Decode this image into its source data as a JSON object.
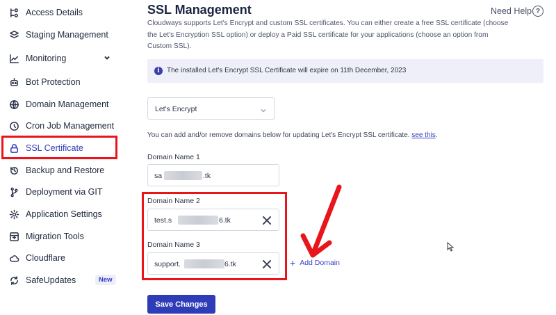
{
  "sidebar": {
    "items": [
      {
        "label": "Access Details"
      },
      {
        "label": "Staging Management"
      },
      {
        "label": "Monitoring"
      },
      {
        "label": "Bot Protection"
      },
      {
        "label": "Domain Management"
      },
      {
        "label": "Cron Job Management"
      },
      {
        "label": "SSL Certificate"
      },
      {
        "label": "Backup and Restore"
      },
      {
        "label": "Deployment via GIT"
      },
      {
        "label": "Application Settings"
      },
      {
        "label": "Migration Tools"
      },
      {
        "label": "Cloudflare"
      },
      {
        "label": "SafeUpdates",
        "badge": "New"
      }
    ]
  },
  "main": {
    "title": "SSL Management",
    "help_label": "Need Help",
    "description": "Cloudways supports Let's Encrypt and custom SSL certificates. You can either create a free SSL certificate (choose the Let's Encryption SSL option) or deploy a Paid SSL certificate for your applications (choose an option from Custom SSL).",
    "notice": "The installed Let's Encrypt SSL Certificate will expire on 11th December, 2023",
    "ssl_type": "Let's Encrypt",
    "hint_text": "You can add and/or remove domains below for updating Let's Encrypt SSL certificate.",
    "hint_link": "see this",
    "hint_suffix": ".",
    "domains": [
      {
        "label": "Domain Name 1",
        "prefix": "sa",
        "suffix": ".tk"
      },
      {
        "label": "Domain Name 2",
        "prefix": "test.s",
        "suffix": "6.tk"
      },
      {
        "label": "Domain Name 3",
        "prefix": "support.",
        "suffix": "6.tk"
      }
    ],
    "add_domain": "Add Domain",
    "save_button": "Save Changes"
  },
  "colors": {
    "accent": "#2f3cb8",
    "highlight": "#e8161c",
    "notice_bg": "#eeeff9"
  }
}
